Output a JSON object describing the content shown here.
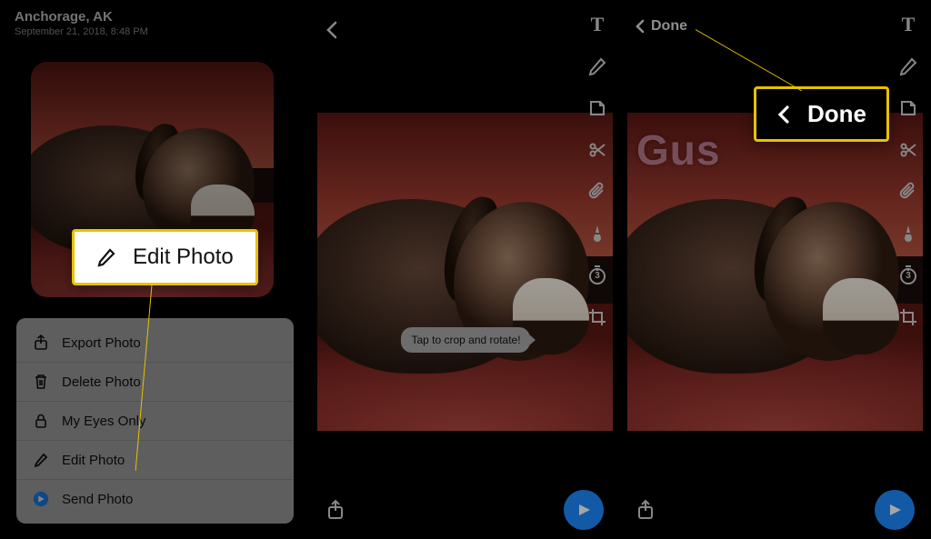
{
  "panel1": {
    "location": "Anchorage, AK",
    "timestamp": "September 21, 2018, 8:48 PM",
    "menu": {
      "export": "Export Photo",
      "delete": "Delete Photo",
      "eyes": "My Eyes Only",
      "edit": "Edit Photo",
      "send": "Send Photo"
    },
    "callout_edit": "Edit Photo"
  },
  "panel2": {
    "tooltip": "Tap to crop and rotate!",
    "tools": {
      "text": "T",
      "timer_value": "3"
    }
  },
  "panel3": {
    "done_label": "Done",
    "caption_text": "Gus",
    "tools": {
      "text": "T",
      "timer_value": "3"
    },
    "callout_done": "Done"
  }
}
